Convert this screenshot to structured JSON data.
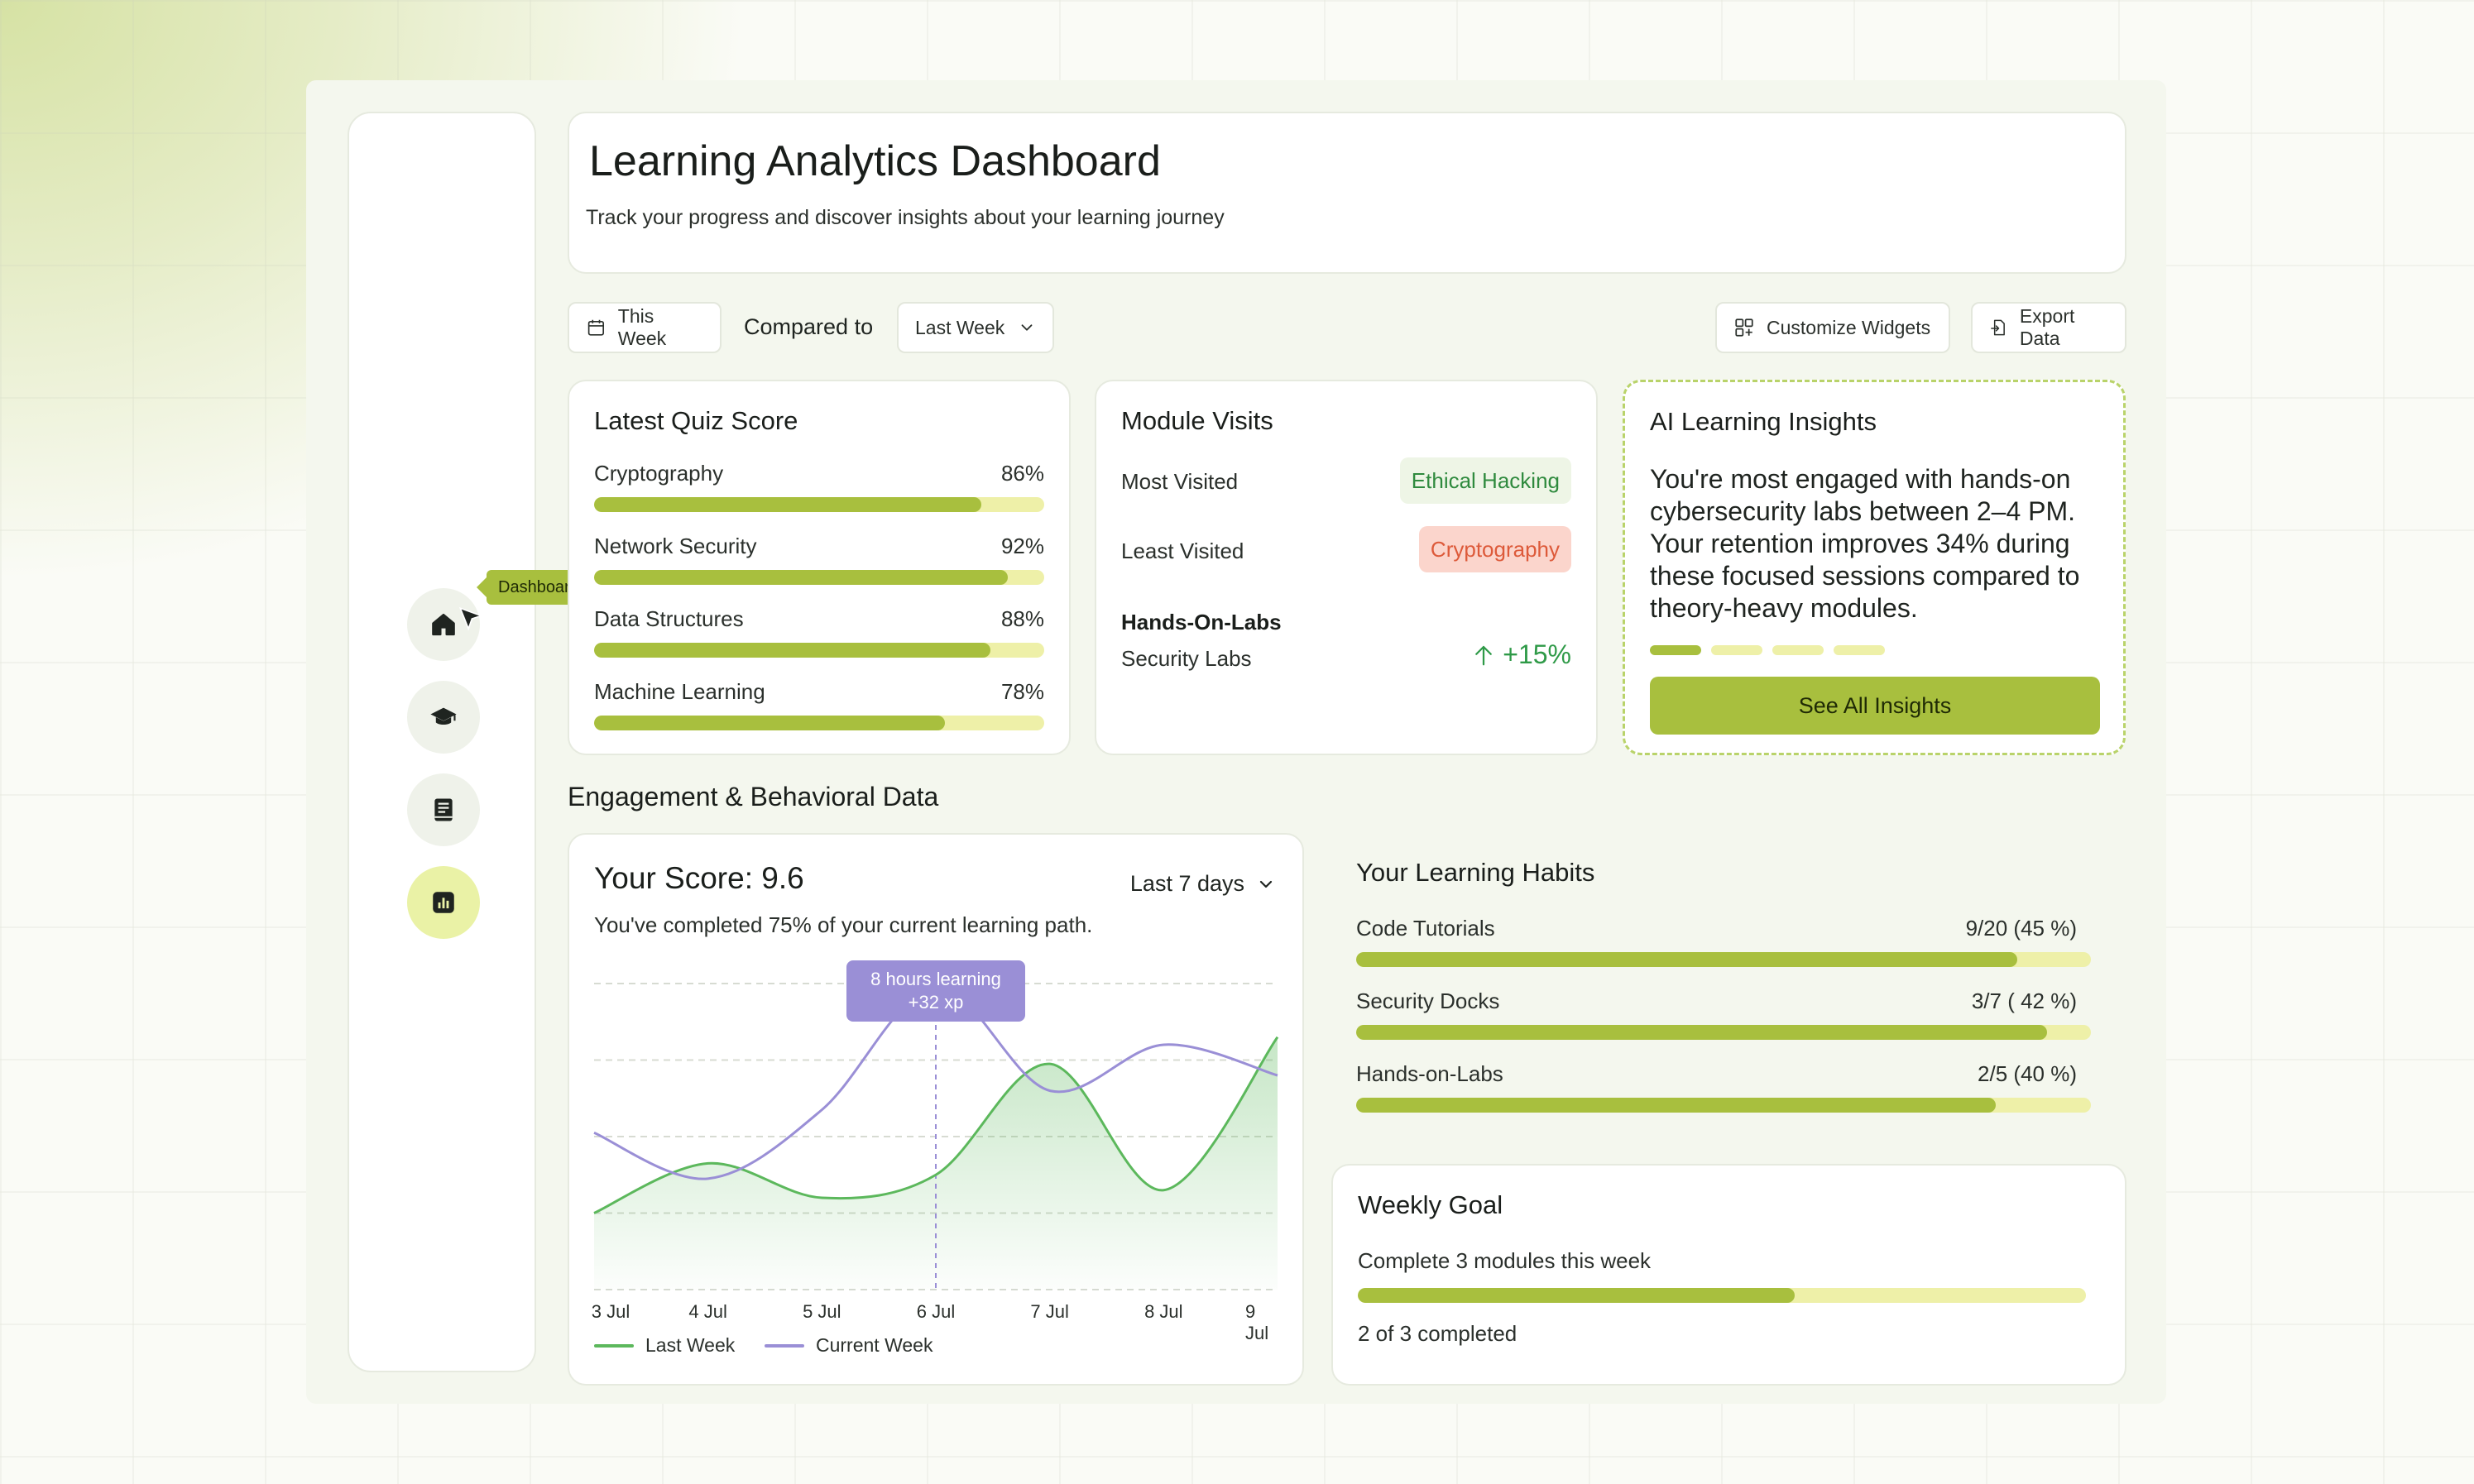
{
  "header": {
    "title": "Learning Analytics Dashboard",
    "subtitle": "Track your progress and discover insights about your learning journey"
  },
  "sidebar": {
    "tooltip": "Dashboard",
    "items": [
      {
        "icon": "home-icon"
      },
      {
        "icon": "graduation-cap-icon"
      },
      {
        "icon": "book-icon"
      },
      {
        "icon": "analytics-icon",
        "active": true
      }
    ]
  },
  "toolbar": {
    "period": "This Week",
    "compared_label": "Compared to",
    "compare_value": "Last Week",
    "customize": "Customize Widgets",
    "export": "Export Data"
  },
  "quiz": {
    "title": "Latest Quiz Score",
    "items": [
      {
        "label": "Cryptography",
        "value": "86%",
        "pct": 86
      },
      {
        "label": "Network Security",
        "value": "92%",
        "pct": 92
      },
      {
        "label": "Data Structures",
        "value": "88%",
        "pct": 88
      },
      {
        "label": "Machine Learning",
        "value": "78%",
        "pct": 78
      }
    ]
  },
  "modules": {
    "title": "Module Visits",
    "most_label": "Most Visited",
    "most_value": "Ethical Hacking",
    "least_label": "Least Visited",
    "least_value": "Cryptography",
    "labs_title": "Hands-On-Labs",
    "labs_label": "Security Labs",
    "labs_change": "+15%"
  },
  "insights": {
    "title": "AI Learning Insights",
    "text": "You're most engaged with hands-on cybersecurity labs between 2–4 PM. Your retention improves 34% during these focused sessions compared to theory-heavy modules.",
    "button": "See All Insights",
    "pages": 4,
    "current_page": 1
  },
  "engagement": {
    "section_title": "Engagement & Behavioral Data"
  },
  "score": {
    "title": "Your Score: 9.6",
    "range": "Last 7 days",
    "subtitle": "You've completed 75% of your current learning path.",
    "tooltip_line1": "8 hours learning",
    "tooltip_line2": "+32 xp"
  },
  "chart_data": {
    "type": "line",
    "x": [
      "3 Jul",
      "4 Jul",
      "5 Jul",
      "6 Jul",
      "7 Jul",
      "8 Jul",
      "9 Jul"
    ],
    "series": [
      {
        "name": "Last Week",
        "color": "#5cb85c",
        "values": [
          1.0,
          1.65,
          1.2,
          1.5,
          2.95,
          1.3,
          3.3
        ]
      },
      {
        "name": "Current Week",
        "color": "#9a8fd6",
        "values": [
          2.05,
          1.45,
          2.35,
          3.95,
          2.6,
          3.2,
          2.8
        ]
      }
    ],
    "ylim": [
      0,
      4
    ],
    "grid": true,
    "highlight_index": 3
  },
  "habits": {
    "title": "Your Learning Habits",
    "items": [
      {
        "label": "Code Tutorials",
        "value": "9/20 (45 %)",
        "pct": 90
      },
      {
        "label": "Security Docks",
        "value": "3/7 ( 42 %)",
        "pct": 94
      },
      {
        "label": "Hands-on-Labs",
        "value": "2/5 (40 %)",
        "pct": 87
      }
    ]
  },
  "goal": {
    "title": "Weekly Goal",
    "subtitle": "Complete 3 modules this week",
    "footer": "2 of 3 completed",
    "pct": 60
  }
}
